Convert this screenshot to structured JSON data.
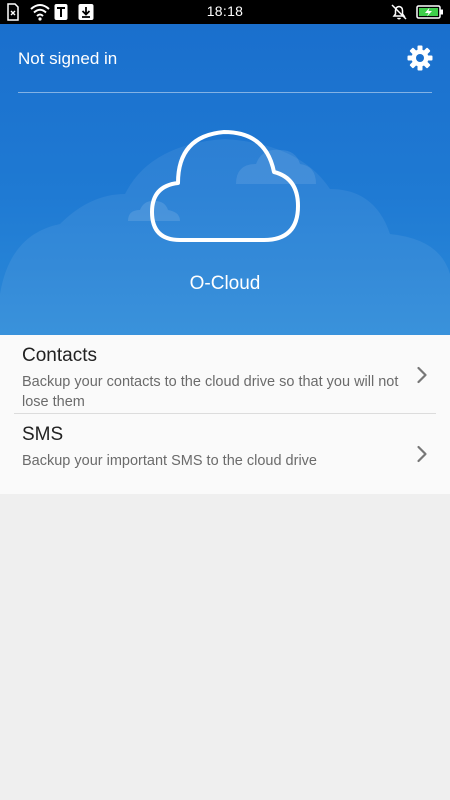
{
  "status_bar": {
    "time": "18:18",
    "icons_left": [
      "sim-missing-icon",
      "wifi-icon",
      "t-mobile-icon",
      "download-icon"
    ],
    "icons_right": [
      "mute-icon",
      "battery-charging-icon"
    ]
  },
  "header": {
    "account_status": "Not signed in",
    "settings_icon": "gear-icon",
    "app_name": "O-Cloud",
    "logo_icon": "cloud-icon"
  },
  "list": {
    "items": [
      {
        "title": "Contacts",
        "description": "Backup your contacts to the cloud drive so that you will not lose them"
      },
      {
        "title": "SMS",
        "description": "Backup your important SMS to the cloud drive"
      }
    ]
  },
  "colors": {
    "header_blue": "#1f7ad3",
    "list_background": "#fafafa",
    "page_background": "#efefef"
  }
}
